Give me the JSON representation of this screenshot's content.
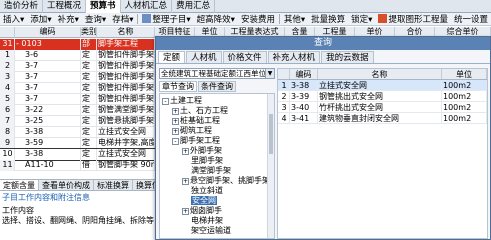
{
  "main_tabs": [
    "造价分析",
    "工程概况",
    "预算书",
    "人材机汇总",
    "费用汇总"
  ],
  "main_tab_active": 2,
  "toolbar": {
    "insert": "插入",
    "add": "添加",
    "supplement": "补充",
    "find": "查询",
    "save": "存档",
    "organize": "整理子目",
    "super_height": "超高降效",
    "install_fee": "安装费用",
    "other": "其他",
    "replace": "批量换算",
    "lock": "锁定",
    "drawing": "提取图形工程量",
    "unified": "统一设置"
  },
  "grid_headers": [
    "编码",
    "类别",
    "名称",
    "项目特征",
    "单位",
    "工程量表达式",
    "含量",
    "工程量",
    "单价",
    "合价",
    "综合单价"
  ],
  "grid_rows": [
    {
      "no": "31",
      "code": "- 0103",
      "type": "部",
      "name": "脚手架工程"
    },
    {
      "no": "1",
      "code": "3-6",
      "type": "定",
      "name": "钢管扣件脚手架15m以"
    },
    {
      "no": "2",
      "code": "3-7",
      "type": "定",
      "name": "钢管扣件脚手架15m以"
    },
    {
      "no": "3",
      "code": "3-7",
      "type": "定",
      "name": "钢管扣件脚手架15m以"
    },
    {
      "no": "4",
      "code": "3-7",
      "type": "定",
      "name": "钢管扣件脚手架15m以"
    },
    {
      "no": "5",
      "code": "3-7",
      "type": "定",
      "name": "钢管扣件脚手架15m以"
    },
    {
      "no": "6",
      "code": "3-22",
      "type": "定",
      "name": "钢管满堂脚手架"
    },
    {
      "no": "7",
      "code": "3-25",
      "type": "定",
      "name": "钢管悬挑脚手架,高度"
    },
    {
      "no": "8",
      "code": "3-38",
      "type": "定",
      "name": "立挂式安全网"
    },
    {
      "no": "9",
      "code": "3-59",
      "type": "定",
      "name": "电梯井字架,高度40m"
    },
    {
      "no": "10",
      "code": "3-38",
      "type": "定",
      "name": "立挂式安全网"
    },
    {
      "no": "11",
      "code": "A11-10",
      "type": "借",
      "name": "钢管脚手架 90m内"
    }
  ],
  "bottom": {
    "tabs": [
      "定额含量",
      "查看单价构成",
      "标准换算",
      "换算信息"
    ],
    "sub_tab": "子目工作内容和附注信息",
    "work_label": "工作内容",
    "work_text": "选择、搭设、翻网绳、阴阳角挂绳、拆除等"
  },
  "dialog": {
    "title": "查询",
    "tabs": [
      "定额",
      "人材机",
      "价格文件",
      "补充人材机",
      "我的云数据"
    ],
    "library": "全统建筑工程基础定额江西单位估价价",
    "search_tabs": [
      "章节查询",
      "条件查询"
    ],
    "tree": [
      {
        "label": "土建工程",
        "level": 0,
        "pm": "-"
      },
      {
        "label": "土、石方工程",
        "level": 1,
        "pm": "+"
      },
      {
        "label": "桩基础工程",
        "level": 1,
        "pm": "+"
      },
      {
        "label": "砌筑工程",
        "level": 1,
        "pm": "+"
      },
      {
        "label": "脚手架工程",
        "level": 1,
        "pm": "-"
      },
      {
        "label": "外脚手架",
        "level": 2,
        "pm": "+"
      },
      {
        "label": "里脚手架",
        "level": 2,
        "pm": ""
      },
      {
        "label": "满堂脚手架",
        "level": 2,
        "pm": ""
      },
      {
        "label": "悬空脚手架、挑脚手架",
        "level": 2,
        "pm": "+"
      },
      {
        "label": "独立斜道",
        "level": 2,
        "pm": ""
      },
      {
        "label": "安全网",
        "level": 2,
        "pm": "",
        "selected": true
      },
      {
        "label": "烟囱脚手",
        "level": 2,
        "pm": "+"
      },
      {
        "label": "电梯井架",
        "level": 2,
        "pm": ""
      },
      {
        "label": "架空运输道",
        "level": 2,
        "pm": ""
      },
      {
        "label": "砌筑工程",
        "level": 1,
        "pm": "+"
      },
      {
        "label": "混凝土及钢筋混凝土工程",
        "level": 1,
        "pm": "+"
      },
      {
        "label": "构件运输及安装工程",
        "level": 1,
        "pm": "+"
      },
      {
        "label": "门窗及木结构工程",
        "level": 1,
        "pm": "+"
      },
      {
        "label": "楼地面工程",
        "level": 1,
        "pm": "+"
      }
    ],
    "table_headers": [
      "",
      "编码",
      "名称",
      "单位"
    ],
    "table_rows": [
      {
        "no": "1",
        "code": "3-38",
        "name": "立挂式安全网",
        "unit": "100m2"
      },
      {
        "no": "2",
        "code": "3-39",
        "name": "钢管挑出式安全网",
        "unit": "100m2"
      },
      {
        "no": "3",
        "code": "3-40",
        "name": "竹杆挑出式安全网",
        "unit": "100m2"
      },
      {
        "no": "4",
        "code": "3-41",
        "name": "建筑物垂直封闭安全网",
        "unit": "100m2"
      }
    ]
  },
  "colors": {
    "highlight_row": "#d8311f",
    "dialog_title": "#5a82b4",
    "tree_selected": "#3a6fb0"
  }
}
